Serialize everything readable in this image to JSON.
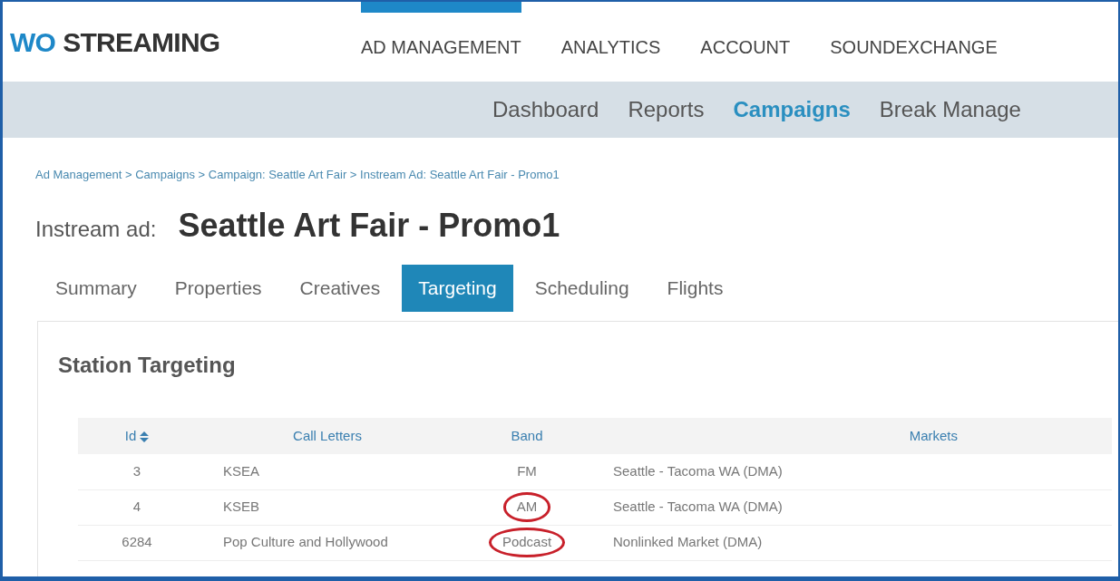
{
  "brand": {
    "accent": "WO",
    "name": "STREAMING"
  },
  "main_nav": [
    {
      "label": "AD MANAGEMENT",
      "selected": true
    },
    {
      "label": "ANALYTICS",
      "selected": false
    },
    {
      "label": "ACCOUNT",
      "selected": false
    },
    {
      "label": "SOUNDEXCHANGE",
      "selected": false
    }
  ],
  "sub_nav": [
    {
      "label": "Dashboard",
      "selected": false
    },
    {
      "label": "Reports",
      "selected": false
    },
    {
      "label": "Campaigns",
      "selected": true
    },
    {
      "label": "Break Manage",
      "selected": false
    }
  ],
  "breadcrumb": "Ad Management > Campaigns > Campaign: Seattle Art Fair > Instream Ad: Seattle Art Fair - Promo1",
  "page_title": {
    "prefix": "Instream ad:",
    "name": "Seattle Art Fair - Promo1"
  },
  "tabs": [
    {
      "label": "Summary",
      "selected": false
    },
    {
      "label": "Properties",
      "selected": false
    },
    {
      "label": "Creatives",
      "selected": false
    },
    {
      "label": "Targeting",
      "selected": true
    },
    {
      "label": "Scheduling",
      "selected": false
    },
    {
      "label": "Flights",
      "selected": false
    }
  ],
  "section_title": "Station Targeting",
  "table": {
    "columns": [
      "Id",
      "Call Letters",
      "Band",
      "Markets"
    ],
    "rows": [
      {
        "id": "3",
        "call_letters": "KSEA",
        "band": "FM",
        "band_circled": false,
        "markets": "Seattle - Tacoma WA (DMA)"
      },
      {
        "id": "4",
        "call_letters": "KSEB",
        "band": "AM",
        "band_circled": true,
        "markets": "Seattle - Tacoma WA (DMA)"
      },
      {
        "id": "6284",
        "call_letters": "Pop Culture and Hollywood",
        "band": "Podcast",
        "band_circled": true,
        "markets": "Nonlinked Market (DMA)"
      }
    ]
  }
}
